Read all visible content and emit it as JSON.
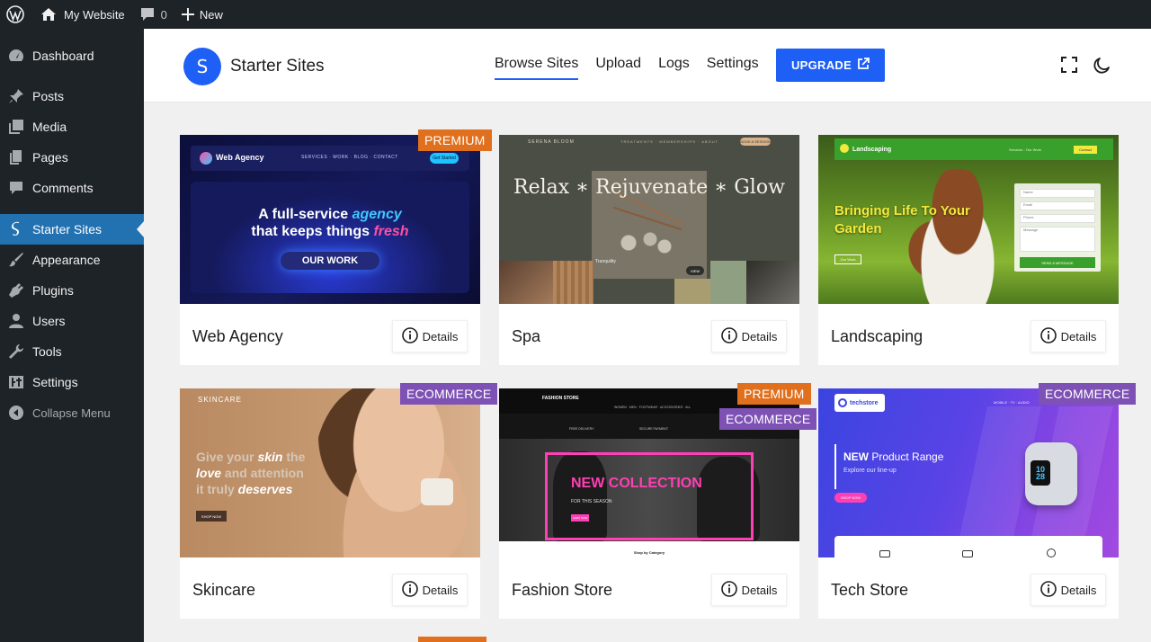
{
  "adminbar": {
    "site_name": "My Website",
    "comments_count": "0",
    "new_label": "New"
  },
  "sidebar": {
    "items": [
      {
        "label": "Dashboard",
        "icon": "dashboard-icon"
      },
      {
        "label": "Posts",
        "icon": "pin-icon"
      },
      {
        "label": "Media",
        "icon": "media-icon"
      },
      {
        "label": "Pages",
        "icon": "pages-icon"
      },
      {
        "label": "Comments",
        "icon": "comment-icon"
      },
      {
        "label": "Starter Sites",
        "icon": "starter-sites-icon",
        "current": true
      },
      {
        "label": "Appearance",
        "icon": "brush-icon"
      },
      {
        "label": "Plugins",
        "icon": "plugin-icon"
      },
      {
        "label": "Users",
        "icon": "user-icon"
      },
      {
        "label": "Tools",
        "icon": "wrench-icon"
      },
      {
        "label": "Settings",
        "icon": "sliders-icon"
      }
    ],
    "collapse_label": "Collapse Menu"
  },
  "header": {
    "logo_letter": "S",
    "brand": "Starter Sites",
    "tabs": [
      "Browse Sites",
      "Upload",
      "Logs",
      "Settings"
    ],
    "active_tab": "Browse Sites",
    "upgrade_label": "UPGRADE"
  },
  "cards": [
    {
      "title": "Web Agency",
      "badges": [
        "PREMIUM"
      ],
      "details_label": "Details",
      "thumb": {
        "brand": "Web Agency",
        "nav": "SERVICES · WORK · BLOG · CONTACT",
        "cta": "Get Started",
        "headline_1": "A full-service",
        "headline_2": "agency",
        "headline_3": "that keeps things",
        "headline_4": "fresh",
        "button": "OUR WORK"
      }
    },
    {
      "title": "Spa",
      "badges": [],
      "details_label": "Details",
      "thumb": {
        "brand": "SERENA BLOOM",
        "nav": "TREATMENTS · MEMBERSHIPS · ABOUT",
        "cta": "BOOK A SESSION",
        "headline": "Relax ∗ Rejuvenate ∗ Glow",
        "caption": "Tranquility",
        "caption_btn": "VIEW"
      }
    },
    {
      "title": "Landscaping",
      "badges": [],
      "details_label": "Details",
      "thumb": {
        "brand": "Landscaping",
        "nav": "Services · Our Work",
        "cta": "Contact",
        "headline_1": "Bringing Life To Your",
        "headline_2": "Garden",
        "button": "Our Work",
        "form_fields": [
          "Name",
          "Email",
          "Phone",
          "Message"
        ],
        "form_button": "SEND A MESSAGE"
      }
    },
    {
      "title": "Skincare",
      "badges": [
        "ECOMMERCE"
      ],
      "details_label": "Details",
      "thumb": {
        "brand": "SKINCARE",
        "line_1a": "Give your ",
        "line_1b": "skin",
        "line_1c": " the",
        "line_2a": "love",
        "line_2b": " and attention",
        "line_3a": "it truly ",
        "line_3b": "deserves",
        "button": "SHOP NOW"
      }
    },
    {
      "title": "Fashion Store",
      "badges": [
        "PREMIUM",
        "ECOMMERCE"
      ],
      "details_label": "Details",
      "thumb": {
        "brand": "FASHION STORE",
        "nav": "WOMEN · MEN · FOOTWEAR · ACCESSORIES · ALL",
        "feature_1": "FREE DELIVERY",
        "feature_2": "SECURE PAYMENT",
        "headline": "NEW COLLECTION",
        "sub": "FOR THIS SEASON",
        "button": "SHOP NOW",
        "footer": "Shop by Category"
      }
    },
    {
      "title": "Tech Store",
      "badges": [
        "ECOMMERCE"
      ],
      "details_label": "Details",
      "thumb": {
        "brand": "techstore",
        "nav": "MOBILE · TV · AUDIO",
        "headline_1": "NEW",
        "headline_2": " Product Range",
        "sub": "Explore our line-up",
        "button": "SHOP NOW",
        "watch_time": "10 28"
      }
    }
  ],
  "colors": {
    "accent": "#1e5ff5",
    "premium": "#e0701d",
    "ecommerce": "#7e52b5",
    "sidebar": "#1d2327",
    "current": "#2271b1"
  }
}
